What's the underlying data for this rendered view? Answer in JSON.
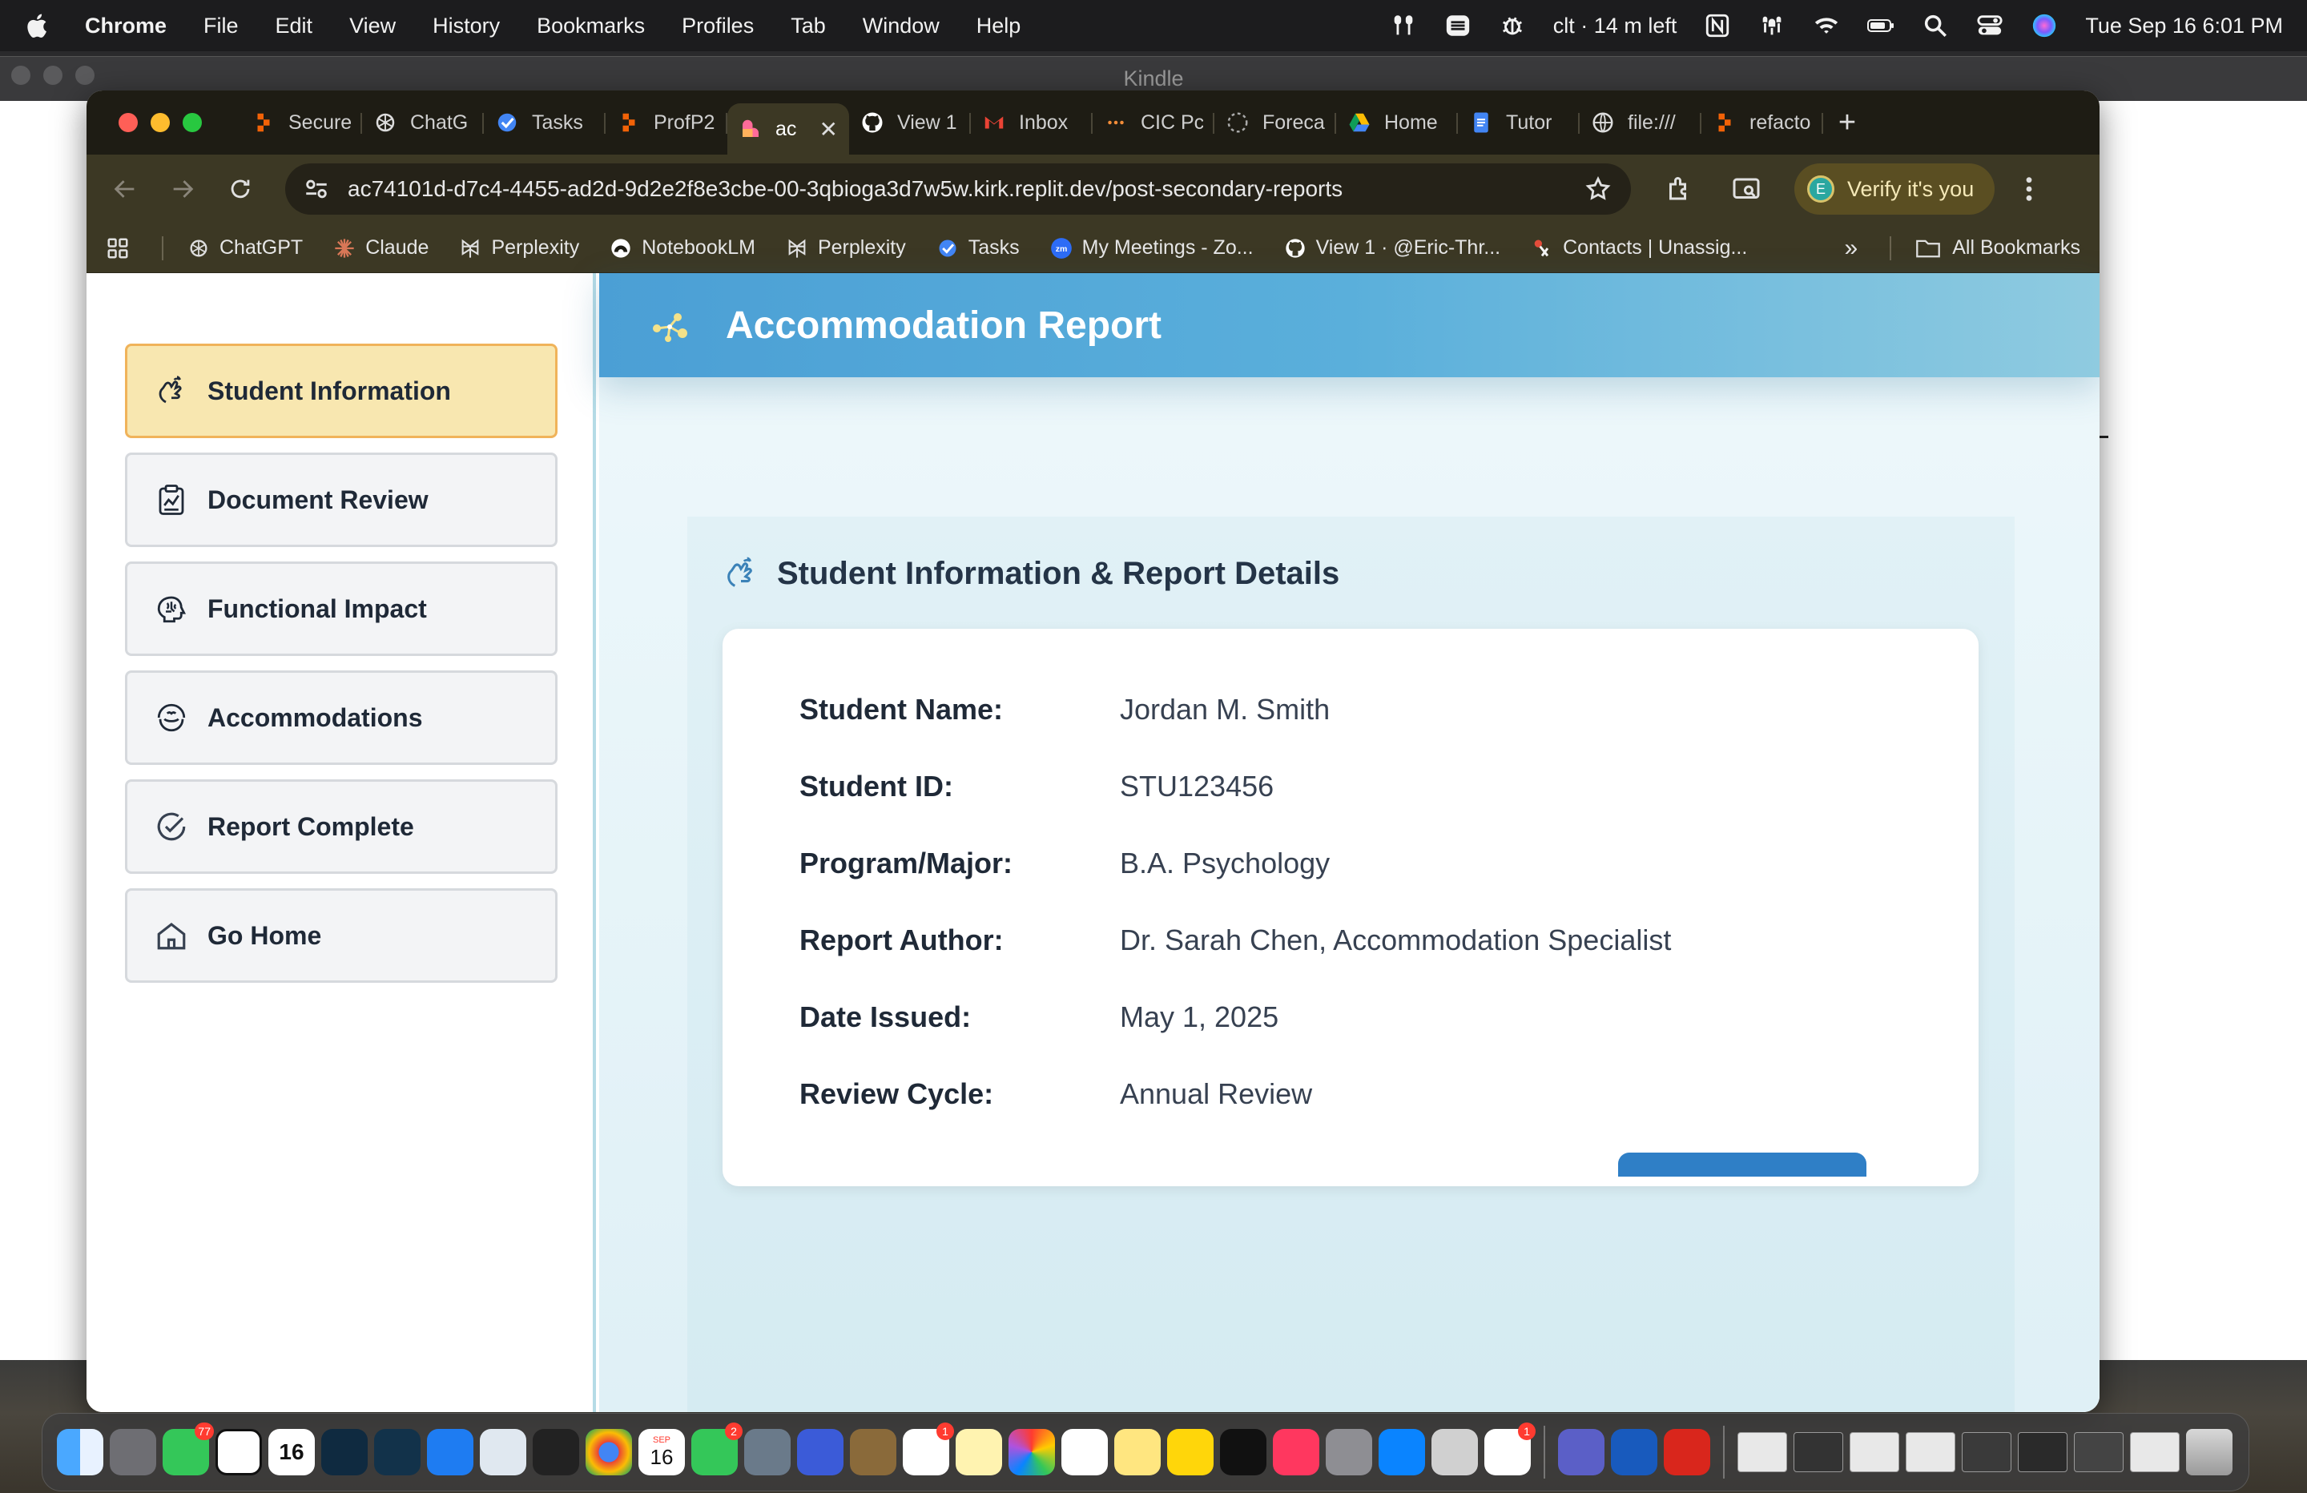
{
  "menubar": {
    "app": "Chrome",
    "items": [
      "File",
      "Edit",
      "View",
      "History",
      "Bookmarks",
      "Profiles",
      "Tab",
      "Window",
      "Help"
    ],
    "status_text": "clt · 14 m left",
    "datetime": "Tue Sep 16  6:01 PM"
  },
  "background_window": {
    "title": "Kindle"
  },
  "browser": {
    "tabs": [
      {
        "label": "Secure",
        "icon": "replit-icon"
      },
      {
        "label": "ChatG",
        "icon": "chatgpt-icon"
      },
      {
        "label": "Tasks",
        "icon": "tasks-icon"
      },
      {
        "label": "ProfP2",
        "icon": "replit-icon"
      },
      {
        "label": "ac",
        "icon": "replit-active-icon",
        "active": true
      },
      {
        "label": "View 1",
        "icon": "github-icon"
      },
      {
        "label": "Inbox",
        "icon": "gmail-icon"
      },
      {
        "label": "CIC Pc",
        "icon": "dots-icon"
      },
      {
        "label": "Foreca",
        "icon": "loading-icon"
      },
      {
        "label": "Home",
        "icon": "drive-icon"
      },
      {
        "label": "Tutor",
        "icon": "docs-icon"
      },
      {
        "label": "file:///",
        "icon": "globe-icon"
      },
      {
        "label": "refacto",
        "icon": "replit-icon"
      }
    ],
    "url": "ac74101d-d7c4-4455-ad2d-9d2e2f8e3cbe-00-3qbioga3d7w5w.kirk.replit.dev/post-secondary-reports",
    "verify_label": "Verify it's you",
    "avatar_letter": "E",
    "bookmarks": [
      {
        "label": "ChatGPT",
        "icon": "chatgpt-icon"
      },
      {
        "label": "Claude",
        "icon": "claude-icon"
      },
      {
        "label": "Perplexity",
        "icon": "perplexity-icon"
      },
      {
        "label": "NotebookLM",
        "icon": "notebooklm-icon"
      },
      {
        "label": "Perplexity",
        "icon": "perplexity-icon"
      },
      {
        "label": "Tasks",
        "icon": "tasks-icon"
      },
      {
        "label": "My Meetings - Zo...",
        "icon": "zoom-icon"
      },
      {
        "label": "View 1 · @Eric-Thr...",
        "icon": "github-icon"
      },
      {
        "label": "Contacts | Unassig...",
        "icon": "contacts-icon"
      }
    ],
    "all_bookmarks": "All Bookmarks"
  },
  "app": {
    "header_title": "Accommodation Report",
    "sidebar": [
      {
        "label": "Student Information",
        "icon": "student-icon",
        "active": true
      },
      {
        "label": "Document Review",
        "icon": "document-icon"
      },
      {
        "label": "Functional Impact",
        "icon": "brain-icon"
      },
      {
        "label": "Accommodations",
        "icon": "hands-icon"
      },
      {
        "label": "Report Complete",
        "icon": "check-circle-icon"
      },
      {
        "label": "Go Home",
        "icon": "home-icon"
      }
    ],
    "section_title": "Student Information & Report Details",
    "fields": [
      {
        "label": "Student Name:",
        "value": "Jordan M. Smith"
      },
      {
        "label": "Student ID:",
        "value": "STU123456"
      },
      {
        "label": "Program/Major:",
        "value": "B.A. Psychology"
      },
      {
        "label": "Report Author:",
        "value": "Dr. Sarah Chen, Accommodation Specialist"
      },
      {
        "label": "Date Issued:",
        "value": "May 1, 2025"
      },
      {
        "label": "Review Cycle:",
        "value": "Annual Review"
      }
    ]
  },
  "dock": {
    "badges": {
      "messages": "77",
      "facetime": "2",
      "reminders": "1",
      "slack": "1"
    },
    "calendar_month": "SEP",
    "calendar_day": "16"
  },
  "colors": {
    "active_nav_bg": "#f8e7b0",
    "active_nav_border": "#f0b35a",
    "header_blue": "#4b9fd5",
    "tab_bar": "#1e1c14",
    "toolbar": "#3c3824"
  }
}
